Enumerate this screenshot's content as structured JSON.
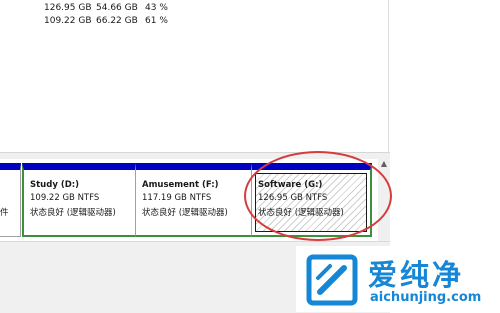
{
  "volume_list": {
    "rows": [
      {
        "capacity": "126.95 GB",
        "free": "54.66 GB",
        "percent_free": "43 %"
      },
      {
        "capacity": "109.22 GB",
        "free": "66.22 GB",
        "percent_free": "61 %"
      }
    ]
  },
  "disk_map": {
    "left_fragment": "件",
    "volumes": [
      {
        "name": "Study  (D:)",
        "size_fs": "109.22 GB NTFS",
        "status": "状态良好 (逻辑驱动器)"
      },
      {
        "name": "Amusement   (F:)",
        "size_fs": "117.19 GB NTFS",
        "status": "状态良好 (逻辑驱动器)"
      },
      {
        "name": "Software  (G:)",
        "size_fs": "126.95 GB NTFS",
        "status": "状态良好 (逻辑驱动器)"
      }
    ]
  },
  "scroll_up_glyph": "▲",
  "colors": {
    "partition_header": "#0000c0",
    "selection_border": "#3c8f3c",
    "annotation_ring": "#d63c3c",
    "watermark": "#1587d6"
  },
  "watermark": {
    "logo_icon": "aichunjing-logo-icon",
    "cn_text": "爱纯净",
    "en_text": "aichunjing.com"
  }
}
